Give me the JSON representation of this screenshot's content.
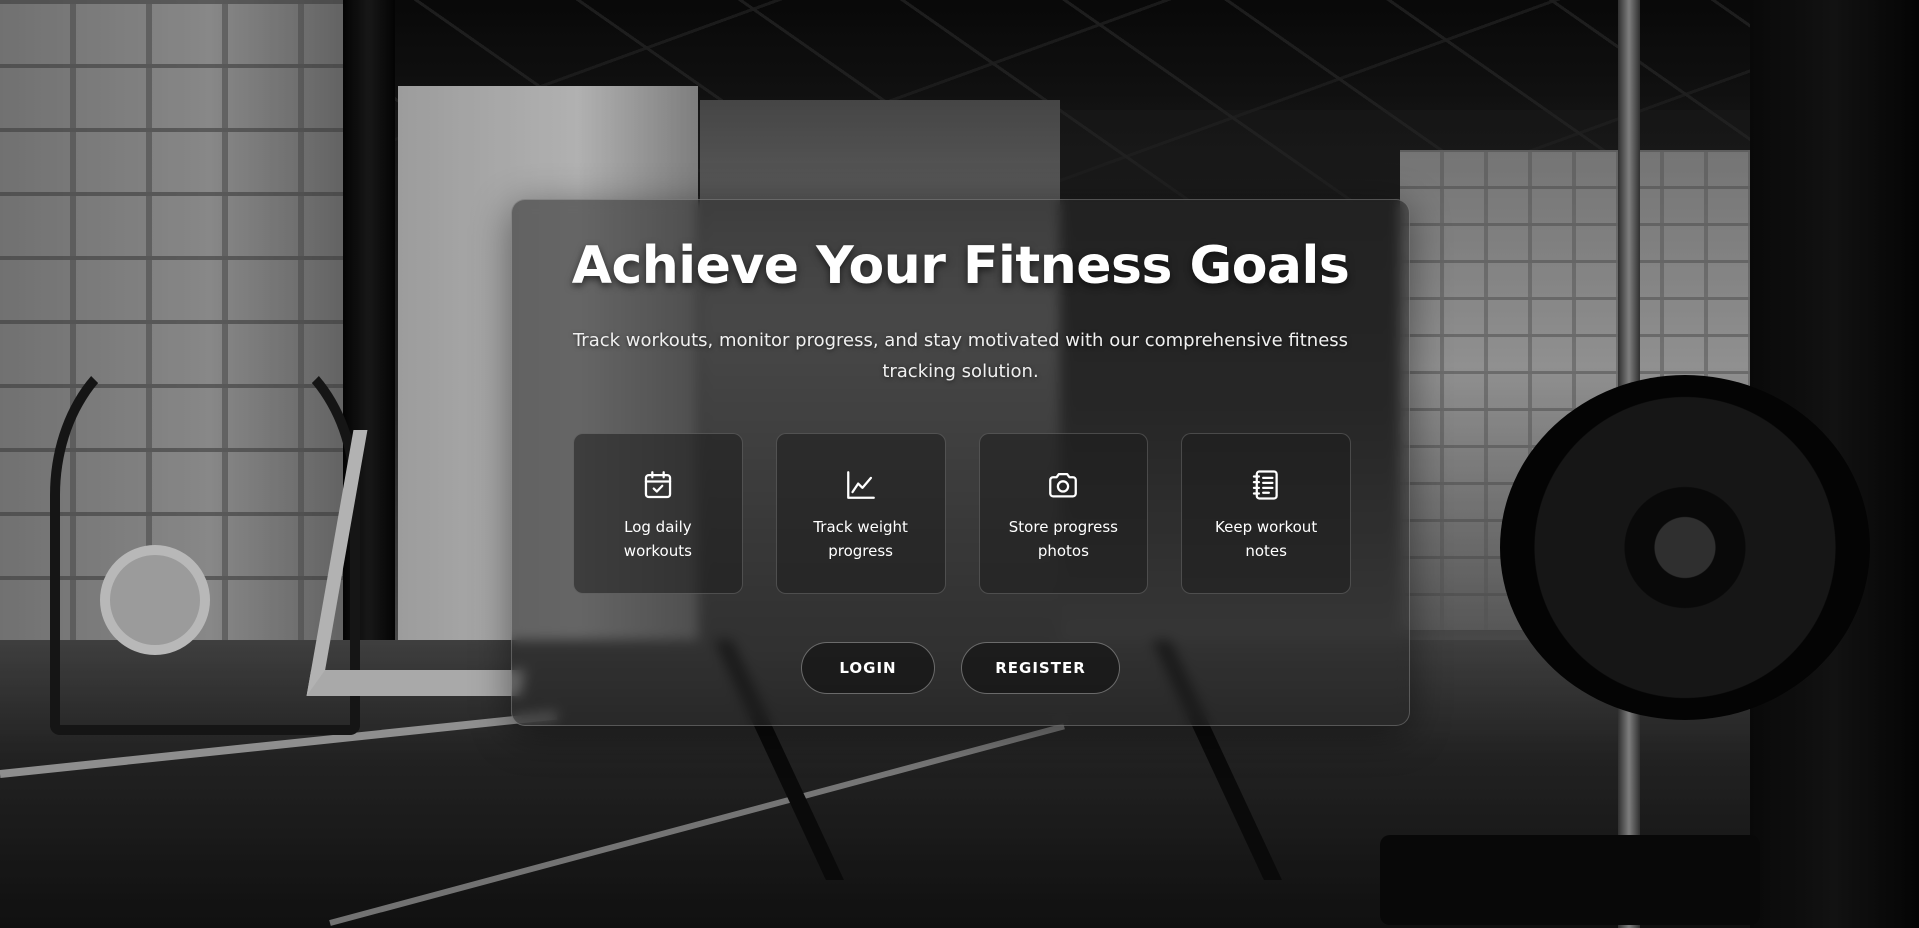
{
  "hero": {
    "title": "Achieve Your Fitness Goals",
    "subtitle": "Track workouts, monitor progress, and stay motivated with our comprehensive fitness tracking solution."
  },
  "features": [
    {
      "icon": "calendar-check-icon",
      "label": "Log daily workouts"
    },
    {
      "icon": "line-chart-icon",
      "label": "Track weight progress"
    },
    {
      "icon": "camera-icon",
      "label": "Store progress photos"
    },
    {
      "icon": "notebook-icon",
      "label": "Keep workout notes"
    }
  ],
  "actions": {
    "login_label": "LOGIN",
    "register_label": "REGISTER"
  },
  "colors": {
    "text": "#ffffff",
    "card_bg": "rgba(40,40,40,0.55)",
    "border": "rgba(255,255,255,0.22)"
  }
}
